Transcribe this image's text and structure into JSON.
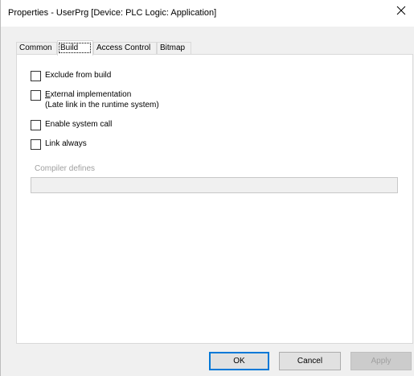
{
  "window": {
    "title": "Properties - UserPrg [Device: PLC Logic: Application]"
  },
  "tabs": [
    {
      "label": "Common",
      "active": false
    },
    {
      "label": "Build",
      "active": true
    },
    {
      "label": "Access Control",
      "active": false
    },
    {
      "label": "Bitmap",
      "active": false
    }
  ],
  "build": {
    "exclude_from_build": {
      "label": "Exclude from build",
      "checked": false
    },
    "external_implementation": {
      "label": "External implementation",
      "sublabel": "(Late link in the runtime system)",
      "checked": false
    },
    "enable_system_call": {
      "label": "Enable system call",
      "checked": false
    },
    "link_always": {
      "label": "Link always",
      "checked": false
    },
    "compiler_defines": {
      "label": "Compiler defines",
      "value": ""
    }
  },
  "buttons": {
    "ok": "OK",
    "cancel": "Cancel",
    "apply": "Apply"
  },
  "colors": {
    "default_button_border": "#0078d7",
    "disabled_text": "#a0a0a0"
  }
}
